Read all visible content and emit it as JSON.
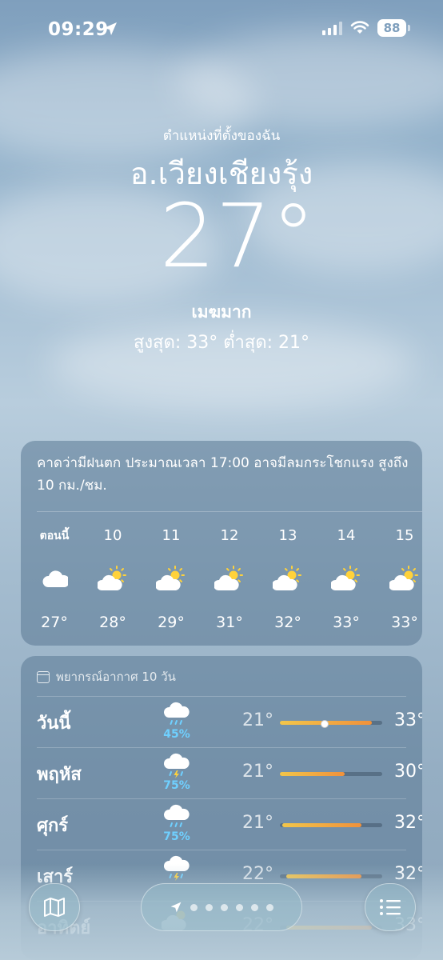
{
  "status_bar": {
    "time": "09:29",
    "battery": "88"
  },
  "header": {
    "my_location": "ตำแหน่งที่ตั้งของฉัน",
    "city": "อ.เวียงเชียงรุ้ง",
    "temperature": "27°",
    "condition": "เมฆมาก",
    "high_low": "สูงสุด: 33°  ต่ำสุด: 21°"
  },
  "hourly": {
    "summary": "คาดว่ามีฝนตก ประมาณเวลา 17:00 อาจมีลมกระโชกแรง สูงถึง 10 กม./ชม.",
    "items": [
      {
        "label": "ตอนนี้",
        "icon": "cloud-icon",
        "temp": "27°"
      },
      {
        "label": "10",
        "icon": "partly-sunny-icon",
        "temp": "28°"
      },
      {
        "label": "11",
        "icon": "partly-sunny-icon",
        "temp": "29°"
      },
      {
        "label": "12",
        "icon": "partly-sunny-icon",
        "temp": "31°"
      },
      {
        "label": "13",
        "icon": "partly-sunny-icon",
        "temp": "32°"
      },
      {
        "label": "14",
        "icon": "partly-sunny-icon",
        "temp": "33°"
      },
      {
        "label": "15",
        "icon": "partly-sunny-icon",
        "temp": "33°"
      }
    ]
  },
  "forecast": {
    "title": "พยากรณ์อากาศ 10 วัน",
    "days": [
      {
        "name": "วันนี้",
        "icon": "rain-cloud-icon",
        "precip": "45%",
        "low": "21°",
        "high": "33°",
        "range": [
          0.0,
          0.9
        ],
        "current": 0.43
      },
      {
        "name": "พฤหัส",
        "icon": "thunderstorm-icon",
        "precip": "75%",
        "low": "21°",
        "high": "30°",
        "range": [
          0.0,
          0.63
        ]
      },
      {
        "name": "ศุกร์",
        "icon": "rain-cloud-icon",
        "precip": "75%",
        "low": "21°",
        "high": "32°",
        "range": [
          0.02,
          0.8
        ]
      },
      {
        "name": "เสาร์",
        "icon": "thunderstorm-icon",
        "precip": "",
        "low": "22°",
        "high": "32°",
        "range": [
          0.06,
          0.8
        ]
      },
      {
        "name": "อาทิตย์",
        "icon": "partly-cloudy-icon",
        "precip": "",
        "low": "22°",
        "high": "33°",
        "range": [
          0.06,
          0.9
        ]
      }
    ]
  },
  "toolbar": {
    "map": "map-icon",
    "location": "location-arrow-icon",
    "list": "list-icon",
    "page_dots": 6
  },
  "colors": {
    "precip": "#6fd0ff",
    "bar_start": "#f3c64a",
    "bar_end": "#f0913b"
  }
}
